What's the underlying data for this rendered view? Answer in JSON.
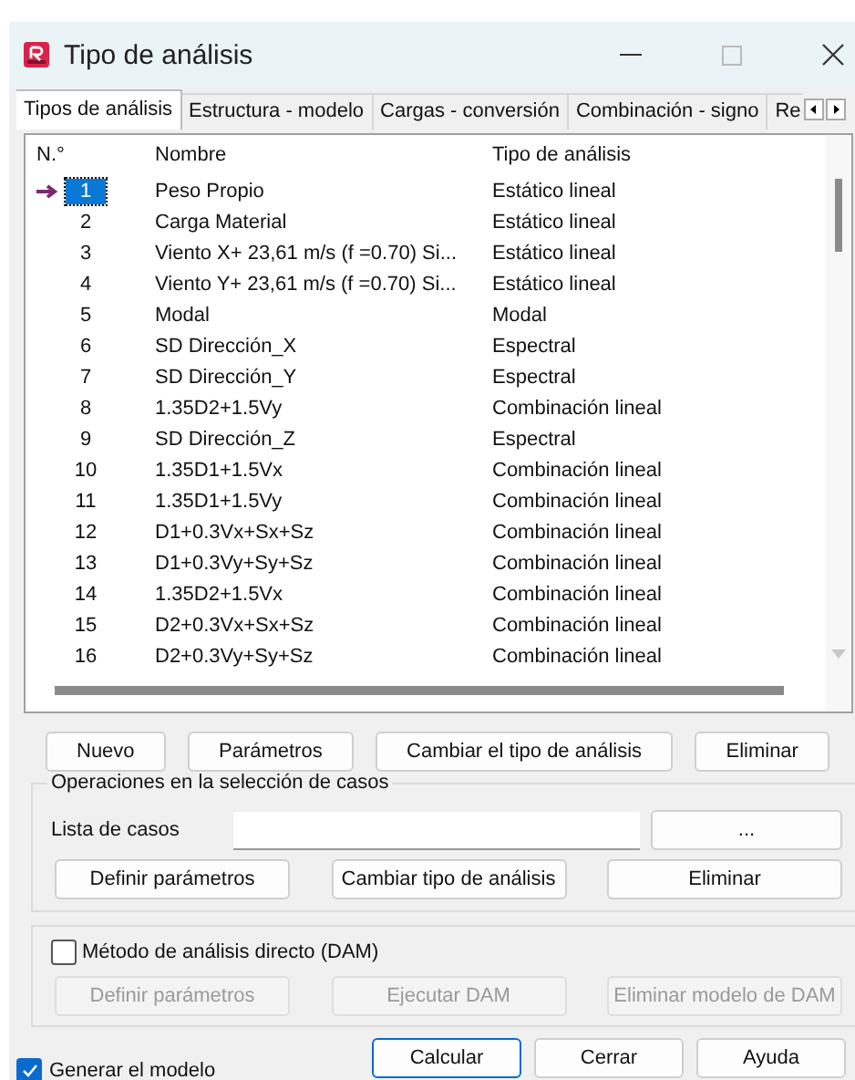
{
  "window": {
    "title": "Tipo de análisis"
  },
  "tabs": [
    {
      "label": "Tipos de análisis",
      "selected": true
    },
    {
      "label": "Estructura - modelo",
      "selected": false
    },
    {
      "label": "Cargas - conversión",
      "selected": false
    },
    {
      "label": "Combinación - signo",
      "selected": false
    },
    {
      "label": "Re",
      "selected": false
    }
  ],
  "table": {
    "columns": [
      "N.°",
      "Nombre",
      "Tipo de análisis"
    ],
    "rows": [
      {
        "number": "1",
        "name": "Peso Propio",
        "type": "Estático lineal",
        "selected": true
      },
      {
        "number": "2",
        "name": "Carga Material",
        "type": "Estático lineal",
        "selected": false
      },
      {
        "number": "3",
        "name": "Viento X+ 23,61 m/s (f =0.70) Si...",
        "type": "Estático lineal",
        "selected": false
      },
      {
        "number": "4",
        "name": "Viento Y+ 23,61 m/s (f =0.70) Si...",
        "type": "Estático lineal",
        "selected": false
      },
      {
        "number": "5",
        "name": "Modal",
        "type": "Modal",
        "selected": false
      },
      {
        "number": "6",
        "name": "SD Dirección_X",
        "type": "Espectral",
        "selected": false
      },
      {
        "number": "7",
        "name": "SD Dirección_Y",
        "type": "Espectral",
        "selected": false
      },
      {
        "number": "8",
        "name": "1.35D2+1.5Vy",
        "type": "Combinación lineal",
        "selected": false
      },
      {
        "number": "9",
        "name": "SD Dirección_Z",
        "type": "Espectral",
        "selected": false
      },
      {
        "number": "10",
        "name": "1.35D1+1.5Vx",
        "type": "Combinación lineal",
        "selected": false
      },
      {
        "number": "11",
        "name": "1.35D1+1.5Vy",
        "type": "Combinación lineal",
        "selected": false
      },
      {
        "number": "12",
        "name": "D1+0.3Vx+Sx+Sz",
        "type": "Combinación lineal",
        "selected": false
      },
      {
        "number": "13",
        "name": "D1+0.3Vy+Sy+Sz",
        "type": "Combinación lineal",
        "selected": false
      },
      {
        "number": "14",
        "name": "1.35D2+1.5Vx",
        "type": "Combinación lineal",
        "selected": false
      },
      {
        "number": "15",
        "name": "D2+0.3Vx+Sx+Sz",
        "type": "Combinación lineal",
        "selected": false
      },
      {
        "number": "16",
        "name": "D2+0.3Vy+Sy+Sz",
        "type": "Combinación lineal",
        "selected": false
      }
    ]
  },
  "case_buttons": [
    {
      "label": "Nuevo"
    },
    {
      "label": "Parámetros"
    },
    {
      "label": "Cambiar el tipo de análisis"
    },
    {
      "label": "Eliminar"
    }
  ],
  "selection_group": {
    "title": "Operaciones en la selección de casos",
    "field_label": "Lista de casos",
    "browse_button": "...",
    "buttons": [
      {
        "label": "Definir parámetros"
      },
      {
        "label": "Cambiar tipo de análisis"
      },
      {
        "label": "Eliminar"
      }
    ]
  },
  "dam_group": {
    "checkbox": {
      "label": "Método de análisis directo (DAM)",
      "checked": false
    },
    "buttons": [
      {
        "label": "Definir parámetros",
        "disabled": true
      },
      {
        "label": "Ejecutar DAM",
        "disabled": true
      },
      {
        "label": "Eliminar modelo de DAM",
        "disabled": true
      }
    ]
  },
  "footer": {
    "checkbox": {
      "label": "Generar el modelo",
      "checked": true
    },
    "buttons": [
      {
        "label": "Calcular",
        "default": true
      },
      {
        "label": "Cerrar",
        "default": false
      },
      {
        "label": "Ayuda",
        "default": false
      }
    ]
  }
}
